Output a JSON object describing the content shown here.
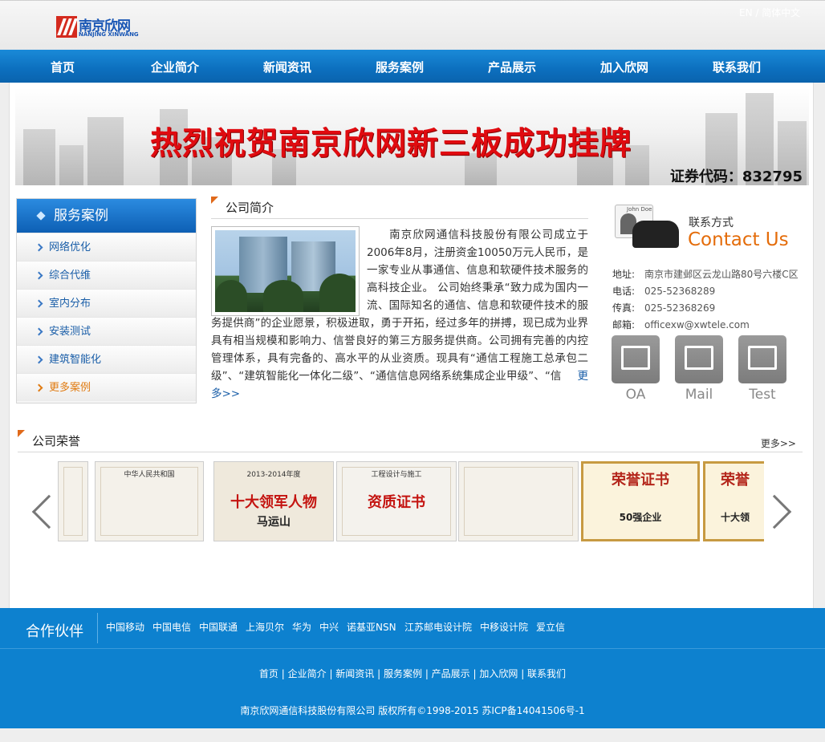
{
  "header": {
    "logo_zh": "南京欣网",
    "logo_en": "NANJING XINWANG",
    "lang": "EN / 简体中文"
  },
  "nav": [
    "首页",
    "企业简介",
    "新闻资讯",
    "服务案例",
    "产品展示",
    "加入欣网",
    "联系我们"
  ],
  "banner": {
    "title": "热烈祝贺南京欣网新三板成功挂牌",
    "code": "证券代码：832795"
  },
  "sidebar": {
    "title": "服务案例",
    "items": [
      "网络优化",
      "综合代维",
      "室内分布",
      "安装测试",
      "建筑智能化"
    ],
    "more": "更多案例"
  },
  "about": {
    "title": "公司简介",
    "text": "南京欣网通信科技股份有限公司成立于2006年8月，注册资金10050万元人民币，是一家专业从事通信、信息和软硬件技术服务的高科技企业。 公司始终秉承“致力成为国内一流、国际知名的通信、信息和软硬件技术的服务提供商”的企业愿景，积极进取，勇于开拓，经过多年的拼搏，现已成为业界具有相当规模和影响力、信誉良好的第三方服务提供商。公司拥有完善的内控管理体系，具有完备的、高水平的从业资质。现具有“通信工程施工总承包二级”、“建筑智能化一体化二级”、“通信信息网络系统集成企业甲级”、“信",
    "more": "更多>>"
  },
  "contact": {
    "card_name": "John Doe",
    "label": "联系方式",
    "label_en": "Contact Us",
    "rows": [
      {
        "k": "地址:",
        "v": "南京市建邺区云龙山路80号六楼C区"
      },
      {
        "k": "电话:",
        "v": "025-52368289"
      },
      {
        "k": "传真:",
        "v": "025-52368269"
      },
      {
        "k": "邮箱:",
        "v": "officexw@xwtele.com"
      }
    ],
    "buttons": [
      "OA",
      "Mail",
      "Test"
    ]
  },
  "honors": {
    "title": "公司荣誉",
    "more": "更多>>",
    "certs": [
      {
        "sub": "",
        "cap": "",
        "name": ""
      },
      {
        "sub": "中华人民共和国",
        "cap": "",
        "name": ""
      },
      {
        "sub": "2013-2014年度",
        "cap": "十大领军人物",
        "name": "马运山"
      },
      {
        "sub": "工程设计与施工",
        "cap": "资质证书",
        "name": ""
      },
      {
        "sub": "",
        "cap": "",
        "name": ""
      },
      {
        "sub": "",
        "cap": "荣誉证书",
        "name": "50强企业"
      },
      {
        "sub": "",
        "cap": "荣誉",
        "name": "十大领"
      }
    ]
  },
  "partners": {
    "title": "合作伙伴",
    "items": [
      "中国移动",
      "中国电信",
      "中国联通",
      "上海贝尔",
      "华为",
      "中兴",
      "诺基亚NSN",
      "江苏邮电设计院",
      "中移设计院",
      "爱立信"
    ]
  },
  "footer": {
    "links": [
      "首页",
      "企业简介",
      "新闻资讯",
      "服务案例",
      "产品展示",
      "加入欣网",
      "联系我们"
    ],
    "copyright": "南京欣网通信科技股份有限公司 版权所有©1998-2015 苏ICP备14041506号-1"
  },
  "colors": {
    "nav_blue": "#0c6fbe",
    "footer_blue": "#0d81cf",
    "accent_orange": "#e46c0a",
    "banner_red": "#e00b10"
  }
}
